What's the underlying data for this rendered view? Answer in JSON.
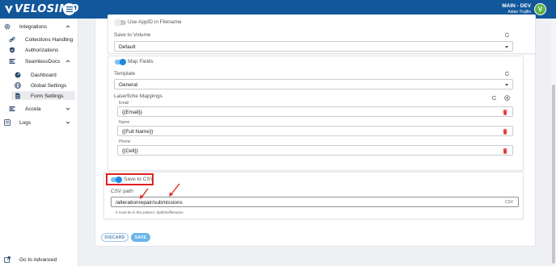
{
  "header": {
    "logo_text": "VELOSIMO",
    "env_title": "MAIN - DEV",
    "user_name": "Aidan Trujillo",
    "avatar_letter": "V",
    "bar_color": "#13579b"
  },
  "sidebar": {
    "items": [
      {
        "label": "Integrations",
        "icon": "gear-icon"
      },
      {
        "label": "Collections Handling",
        "icon": "link-icon"
      },
      {
        "label": "Authorizations",
        "icon": "shield-icon"
      },
      {
        "label": "SeamlessDocs",
        "icon": "layers-icon"
      },
      {
        "label": "Dashboard",
        "icon": "dashboard-icon"
      },
      {
        "label": "Global Settings",
        "icon": "globe-icon"
      },
      {
        "label": "Form Settings",
        "icon": "document-icon"
      },
      {
        "label": "Accela",
        "icon": "layers-icon"
      },
      {
        "label": "Logs",
        "icon": "logs-icon"
      }
    ],
    "go_to_advanced": "Go to Advanced"
  },
  "form": {
    "use_appid_label": "Use AppID in Filename",
    "save_to_volume_label": "Save to Volume",
    "save_to_volume_value": "Default",
    "map_fields_label": "Map Fields",
    "template_label": "Template",
    "template_value": "General",
    "laserfiche_label": "Laserfiche Mappings",
    "mappings": [
      {
        "label": "Email",
        "value": "{{Email}}"
      },
      {
        "label": "Name",
        "value": "{{Full Name}}"
      },
      {
        "label": "Phone",
        "value": "{{Cell}}"
      }
    ],
    "save_csv_label": "Save to CSV",
    "csv_path_label": "CSV path",
    "csv_path_value": "/alterationrepair/submissions",
    "csv_suffix": "CSV",
    "csv_hint": "It must be in this pattern: /path/to/filename",
    "discard_label": "DISCARD",
    "save_label": "SAVE"
  },
  "colors": {
    "accent": "#1e88e5",
    "annotation": "#e02020",
    "trash": "#e53935"
  }
}
